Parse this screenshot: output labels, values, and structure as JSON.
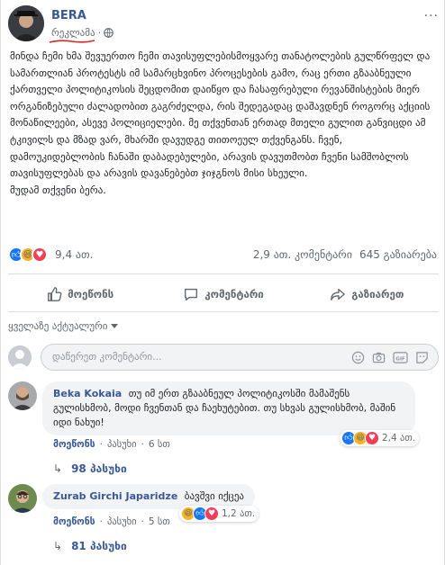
{
  "post": {
    "author": "BERA",
    "sponsored_label": "რეკლამა",
    "dots": "···",
    "text": "მინდა ჩემი ხმა შევუერთო ჩემი თავისუფლებისმოყვარე თანატოლების გულწრფელ და სამართლიან პროტესტს იმ სამარცხვინო პროცესების გამო, რაც ერთი გზააბნეული ქართველი პოლიტიკოსის შეცდომით დაიწყო და ჩასაფრებული რევანშისტების მიერ ორგანიზებული ძალადობით გაგრძელდა, რის შედეგადაც დაშავდნენ როგორც აქციის მონაწილეები, ასევე პოლიციელები. მე თქვენთან ერთად მთელი გულით განვიცდი ამ ტკივილს და მზად ვარ, მხარში დავუდგე თითოეულ თქვენგანს. ჩვენ, დამოუკიდებლობის ჩანაში დაბადებულები, არავის დავუთმობთ ჩვენი სამშობლოს თავისუფლებას და არავის დავანებებთ ჯიჯგნოს მისი სხეული.\nმუდამ თქვენი ბერა."
  },
  "reactions": {
    "count": "9,4 ათ.",
    "comments": "2,9 ათ. კომენტარი",
    "shares": "645 გაზიარება"
  },
  "actions": {
    "like": "მოეწონს",
    "comment": "კომენტარი",
    "share": "გაზიარეთ"
  },
  "sort": {
    "label": "ყველაზე აქტუალური"
  },
  "comment_input": {
    "placeholder": "დაწერეთ კომენტარი..."
  },
  "comments": [
    {
      "author": "Beka Kokaia",
      "text": "თუ იმ ერთ გზააბნეულ პოლიტიკოსში მამაშენს გულისხმობ, მოდი ჩვენთან და ჩაეხუტებით. თუ სხვას გულისხმობ, მაშინ იდი ნახუი!",
      "like_label": "მოეწონს",
      "reply_label": "პასუხი",
      "time": "6 სთ",
      "reaction_count": "2,4 ათ.",
      "replies": "98 პასუხი"
    },
    {
      "author": "Zurab Girchi Japaridze",
      "text": "ბავშვი იქცეა",
      "like_label": "მოეწონს",
      "reply_label": "პასუხი",
      "time": "5 სთ",
      "reaction_count": "1,2 ათ.",
      "replies": "81 პასუხი"
    }
  ],
  "colors": {
    "link": "#385898",
    "like": "#1877f2",
    "haha": "#f7b125",
    "love": "#f33e58",
    "annotation": "#d7261e"
  }
}
